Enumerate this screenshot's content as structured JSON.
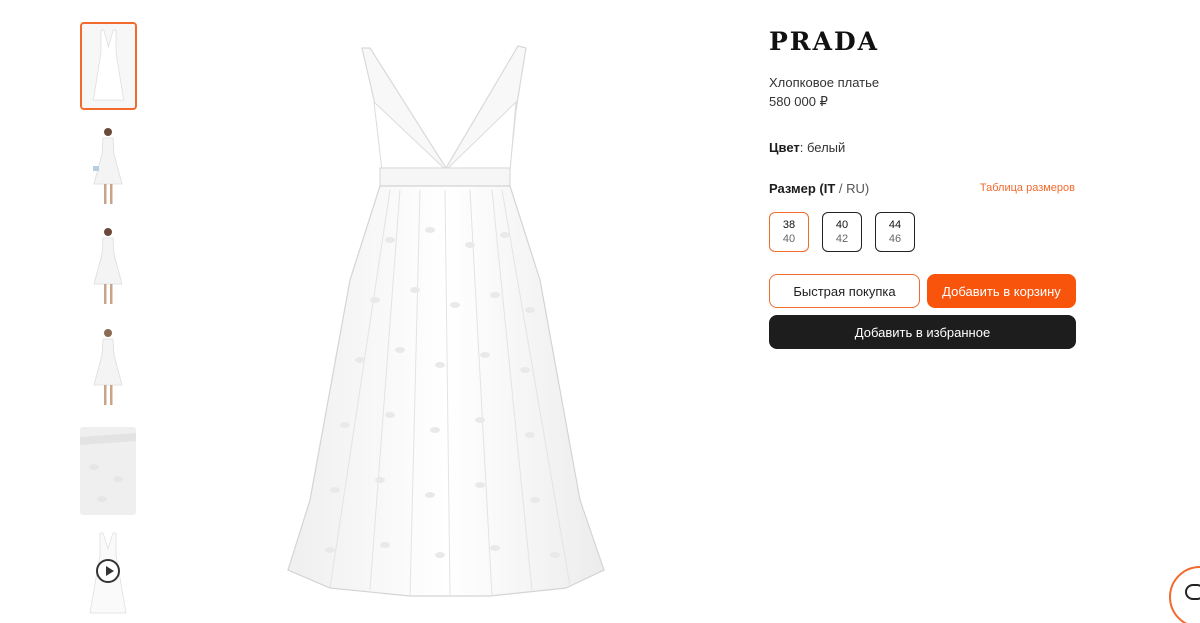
{
  "product": {
    "brand": "PRADA",
    "name": "Хлопковое платье",
    "price": "580 000 ₽"
  },
  "color": {
    "label": "Цвет",
    "value": ": белый"
  },
  "size": {
    "label": "Размер (IT",
    "label_rest": " / RU)",
    "table_link": "Таблица размеров",
    "options": [
      {
        "it": "38",
        "ru": "40",
        "selected": true
      },
      {
        "it": "40",
        "ru": "42",
        "selected": false
      },
      {
        "it": "44",
        "ru": "46",
        "selected": false
      }
    ]
  },
  "actions": {
    "quick_buy": "Быстрая покупка",
    "add_to_cart": "Добавить в корзину",
    "add_to_favorites": "Добавить в избранное"
  },
  "thumbnails": [
    {
      "name": "thumb-front",
      "active": true
    },
    {
      "name": "thumb-model-front"
    },
    {
      "name": "thumb-model-side"
    },
    {
      "name": "thumb-model-back"
    },
    {
      "name": "thumb-fabric-detail"
    },
    {
      "name": "thumb-video",
      "icon": "play-icon"
    }
  ],
  "colors": {
    "accent": "#f26a2e",
    "cart": "#f8540c",
    "dark_button": "#1d1d1d"
  },
  "icons": {
    "chat": "chat-icon",
    "video": "play-icon"
  }
}
